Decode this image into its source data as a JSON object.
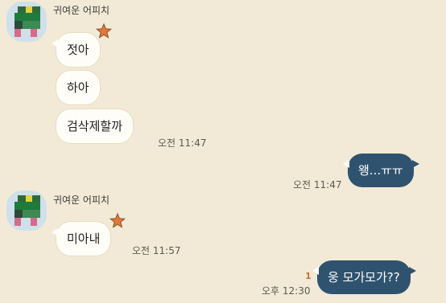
{
  "chat": {
    "group1": {
      "sender": "귀여운 어피치",
      "avatar_icon": "peach-character-avatar-pixelated",
      "messages": [
        "젓아",
        "하아",
        "검삭제할까"
      ],
      "time": "오전 11:47"
    },
    "mine1": {
      "message": "왱...ㅠㅠ",
      "time": "오전 11:47"
    },
    "group2": {
      "sender": "귀여운 어피치",
      "avatar_icon": "peach-character-avatar-pixelated",
      "messages": [
        "미아내"
      ],
      "time": "오전 11:57"
    },
    "mine2": {
      "message": "웅 모가모가??",
      "time": "오후 12:30",
      "unread": "1"
    }
  },
  "colors": {
    "background": "#f2ead6",
    "my_bubble": "#2f536f",
    "their_bubble": "#fffdf8",
    "unread": "#c8722c",
    "star": "#e07a3a"
  }
}
